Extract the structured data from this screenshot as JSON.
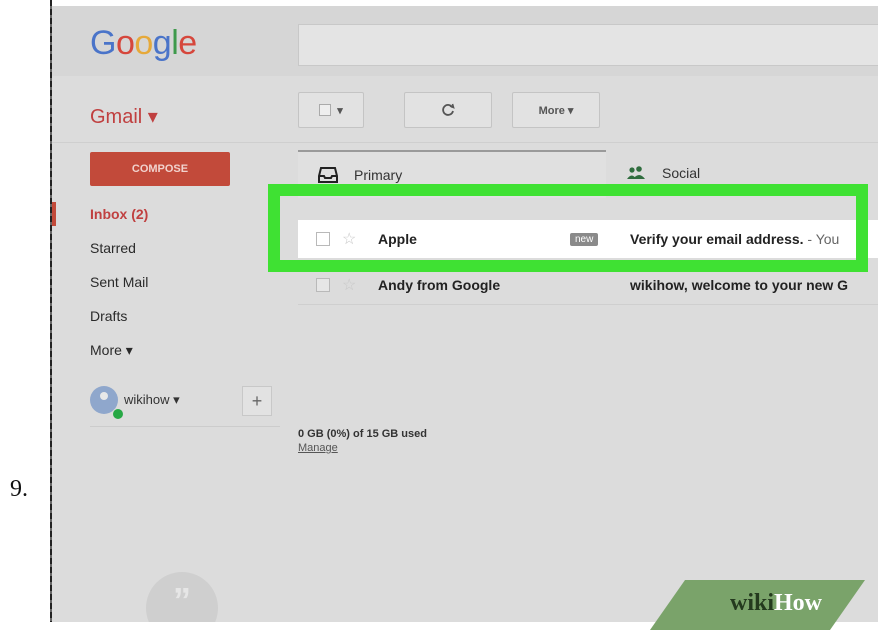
{
  "step": {
    "number": "9."
  },
  "header": {
    "logo_letters": [
      "G",
      "o",
      "o",
      "g",
      "l",
      "e"
    ],
    "logo_colors": [
      "#4a74c9",
      "#d6473c",
      "#e6a93a",
      "#4a74c9",
      "#3f9a4c",
      "#d6473c"
    ]
  },
  "toolbar": {
    "app_label": "Gmail ▾",
    "select_dropdown": "▾",
    "refresh_icon": "refresh-icon",
    "more_label": "More ▾"
  },
  "sidebar": {
    "compose_label": "COMPOSE",
    "items": [
      {
        "label": "Inbox (2)",
        "active": true
      },
      {
        "label": "Starred"
      },
      {
        "label": "Sent Mail"
      },
      {
        "label": "Drafts"
      },
      {
        "label": "More ▾"
      }
    ],
    "account": {
      "name": "wikihow ▾",
      "add_label": "+"
    }
  },
  "tabs": [
    {
      "label": "Primary",
      "icon": "inbox-icon"
    },
    {
      "label": "Social",
      "icon": "people-icon"
    }
  ],
  "messages": [
    {
      "sender": "Apple",
      "badge": "new",
      "subject": "Verify your email address.",
      "snippet": " - You"
    },
    {
      "sender": "Andy from Google",
      "subject": "wikihow, welcome to your new G"
    }
  ],
  "storage": {
    "usage": "0 GB (0%) of 15 GB used",
    "manage": "Manage"
  },
  "hangouts": {
    "glyph": "”"
  },
  "watermark": {
    "wiki": "wiki",
    "how": "How"
  },
  "colors": {
    "highlight": "#3fe133",
    "compose": "#c24a3a",
    "accent_red": "#c04040"
  }
}
